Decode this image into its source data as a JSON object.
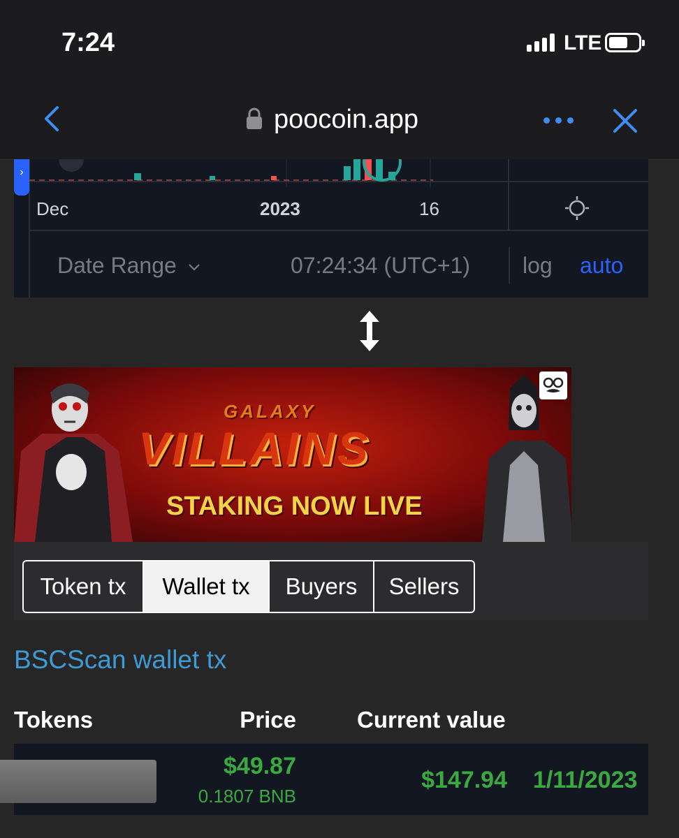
{
  "status_bar": {
    "time": "7:24",
    "network": "LTE",
    "battery": "charged"
  },
  "browser": {
    "url": "poocoin.app"
  },
  "chart_widget": {
    "axis_labels": [
      "Dec",
      "2023",
      "16"
    ],
    "date_range_label": "Date Range",
    "clock": "07:24:34 (UTC+1)",
    "log_label": "log",
    "auto_label": "auto"
  },
  "banner": {
    "small_text": "GALAXY",
    "title": "VILLAINS",
    "subtitle": "STAKING NOW LIVE"
  },
  "tabs": [
    {
      "label": "Token tx",
      "active": false
    },
    {
      "label": "Wallet tx",
      "active": true
    },
    {
      "label": "Buyers",
      "active": false
    },
    {
      "label": "Sellers",
      "active": false
    }
  ],
  "bscscan_link": "BSCScan wallet tx",
  "table": {
    "headers": [
      "Tokens",
      "Price",
      "Current value"
    ],
    "rows": [
      {
        "price_usd": "$49.87",
        "price_bnb": "0.1807 BNB",
        "current_value": "$147.94",
        "date": "1/11/2023"
      }
    ]
  },
  "colors": {
    "accent": "#2962ff",
    "link": "#3f9ad4",
    "positive": "#3aa940"
  }
}
